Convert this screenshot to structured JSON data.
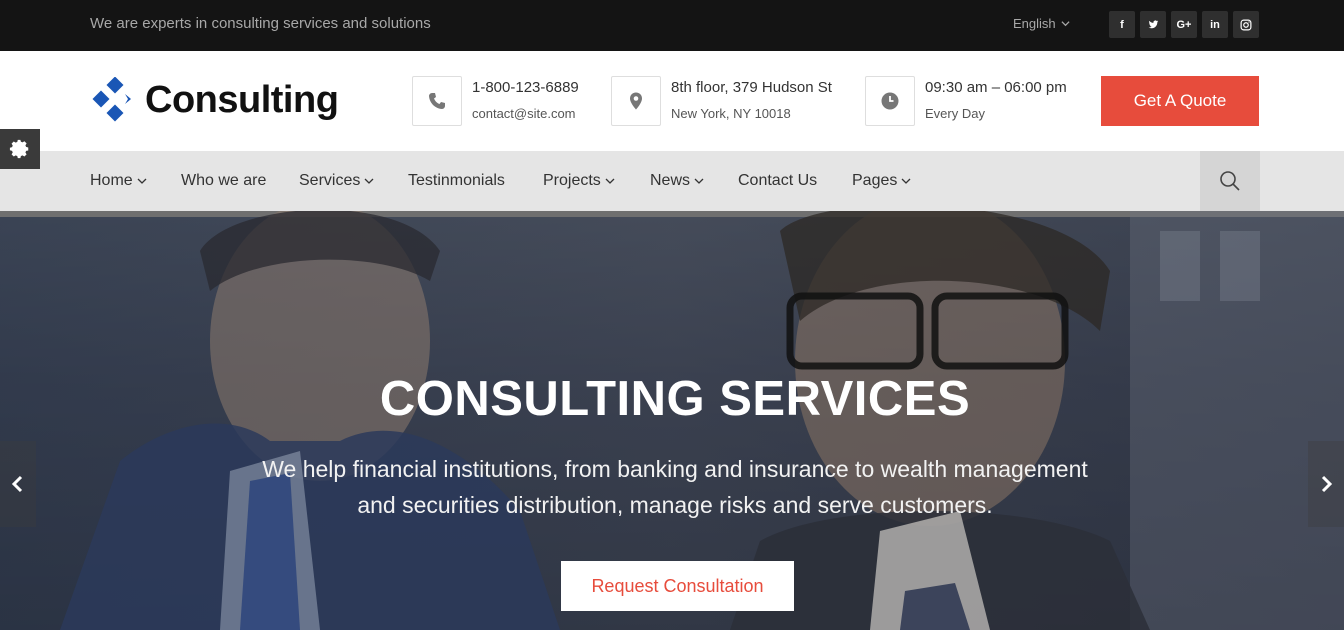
{
  "topbar": {
    "tagline": "We are experts in consulting services and solutions",
    "language": "English",
    "social": [
      {
        "icon": "facebook-icon",
        "glyph": "f"
      },
      {
        "icon": "twitter-icon",
        "glyph": "t"
      },
      {
        "icon": "google-plus-icon",
        "glyph": "G+"
      },
      {
        "icon": "linkedin-icon",
        "glyph": "in"
      },
      {
        "icon": "instagram-icon",
        "glyph": "◎"
      }
    ]
  },
  "header": {
    "logo_text": "Consulting",
    "phone": {
      "main": "1-800-123-6889",
      "sub": "contact@site.com",
      "icon": "phone-icon"
    },
    "address": {
      "main": "8th floor, 379 Hudson St",
      "sub": "New York, NY 10018",
      "icon": "map-pin-icon"
    },
    "hours": {
      "main": "09:30 am – 06:00 pm",
      "sub": "Every Day",
      "icon": "clock-icon"
    },
    "quote_button": "Get A Quote"
  },
  "nav": {
    "items": [
      {
        "label": "Home",
        "dropdown": true
      },
      {
        "label": "Who we are",
        "dropdown": false
      },
      {
        "label": "Services",
        "dropdown": true
      },
      {
        "label": "Testinmonials",
        "dropdown": false
      },
      {
        "label": "Projects",
        "dropdown": true
      },
      {
        "label": "News",
        "dropdown": true
      },
      {
        "label": "Contact Us",
        "dropdown": false
      },
      {
        "label": "Pages",
        "dropdown": true
      }
    ]
  },
  "hero": {
    "title": "CONSULTING SERVICES",
    "line1": "We help financial institutions, from banking and insurance to wealth management",
    "line2": "and securities distribution, manage risks and serve customers.",
    "button": "Request Consultation"
  },
  "colors": {
    "accent": "#e74c3c",
    "brand_blue": "#1a56b5",
    "topbar": "#141414",
    "nav_bg": "#e5e5e5"
  }
}
